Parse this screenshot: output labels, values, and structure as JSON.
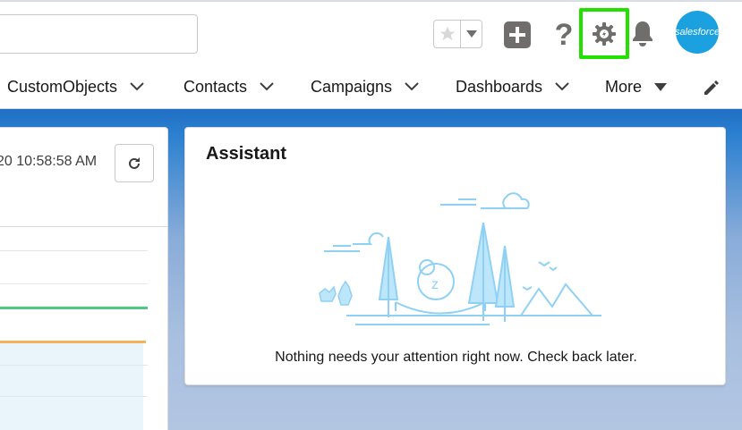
{
  "header": {
    "search": {
      "placeholder": "",
      "value": ""
    },
    "icons": [
      "favorites-star-icon",
      "favorites-dropdown-icon",
      "global-add-icon",
      "help-icon",
      "setup-gear-icon",
      "notifications-bell-icon"
    ],
    "avatar_label": "salesforce",
    "highlight_color": "#22e000"
  },
  "nav": {
    "items": [
      {
        "label": "CustomObjects"
      },
      {
        "label": "Contacts"
      },
      {
        "label": "Campaigns"
      },
      {
        "label": "Dashboards"
      },
      {
        "label": "More"
      }
    ]
  },
  "left_card": {
    "timestamp": "20 10:58:58 AM"
  },
  "assistant": {
    "title": "Assistant",
    "message": "Nothing needs your attention right now. Check back later."
  },
  "colors": {
    "brand_blue": "#1f6fc4",
    "icon_gray": "#706e6b",
    "illustration_blue": "#8fd1f5"
  }
}
